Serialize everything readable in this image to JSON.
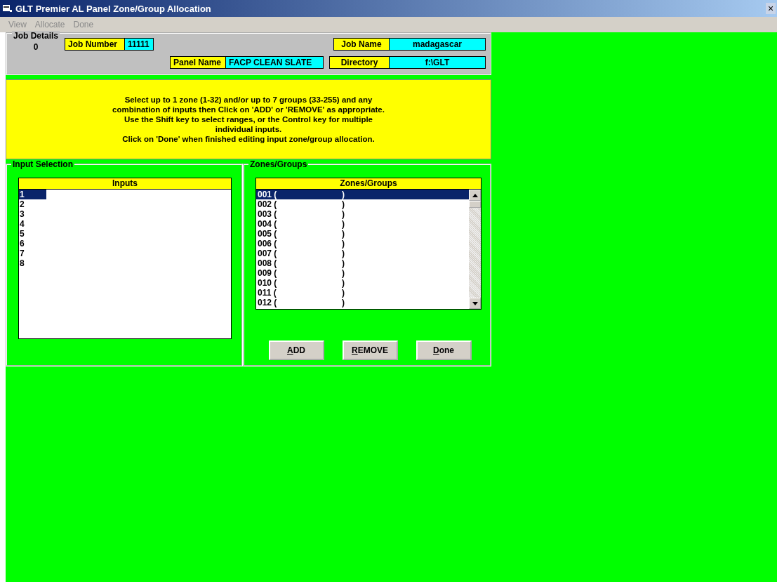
{
  "window": {
    "title": "GLT Premier AL Panel Zone/Group Allocation",
    "close": "×"
  },
  "menu": [
    {
      "label": "View",
      "disabled": true
    },
    {
      "label": "Allocate",
      "disabled": true
    },
    {
      "label": "Done",
      "disabled": true
    }
  ],
  "job_details": {
    "legend": "Job Details",
    "value": "0",
    "fields": [
      {
        "label": "Job Number",
        "value": "11111"
      },
      {
        "label": "Job Name",
        "value": "madagascar"
      },
      {
        "label": "Panel Name",
        "value": "FACP CLEAN SLATE"
      },
      {
        "label": "Directory",
        "value": "f:\\GLT"
      }
    ]
  },
  "instructions": [
    "Select up to 1 zone (1-32) and/or up to 7 groups (33-255) and any",
    "combination of inputs then Click on 'ADD' or 'REMOVE' as appropriate.",
    "Use the Shift key to select ranges, or the Control key for multiple",
    "individual inputs.",
    "Click on 'Done' when finished editing input zone/group allocation."
  ],
  "input_selection": {
    "legend": "Input Selection",
    "header": "Inputs",
    "items": [
      {
        "text": "1",
        "selected": true
      },
      {
        "text": "2",
        "selected": false
      },
      {
        "text": "3",
        "selected": false
      },
      {
        "text": "4",
        "selected": false
      },
      {
        "text": "5",
        "selected": false
      },
      {
        "text": "6",
        "selected": false
      },
      {
        "text": "7",
        "selected": false
      },
      {
        "text": "8",
        "selected": false
      }
    ]
  },
  "zones_groups": {
    "legend": "Zones/Groups",
    "header": "Zones/Groups",
    "items": [
      {
        "text": "001 (",
        "end": ")",
        "selected": true
      },
      {
        "text": "002 (",
        "end": ")",
        "selected": false
      },
      {
        "text": "003 (",
        "end": ")",
        "selected": false
      },
      {
        "text": "004 (",
        "end": ")",
        "selected": false
      },
      {
        "text": "005 (",
        "end": ")",
        "selected": false
      },
      {
        "text": "006 (",
        "end": ")",
        "selected": false
      },
      {
        "text": "007 (",
        "end": ")",
        "selected": false
      },
      {
        "text": "008 (",
        "end": ")",
        "selected": false
      },
      {
        "text": "009 (",
        "end": ")",
        "selected": false
      },
      {
        "text": "010 (",
        "end": ")",
        "selected": false
      },
      {
        "text": "011 (",
        "end": ")",
        "selected": false
      },
      {
        "text": "012 (",
        "end": ")",
        "selected": false
      }
    ]
  },
  "buttons": [
    {
      "access_key": "A",
      "label_rest": "DD"
    },
    {
      "access_key": "R",
      "label_rest": "EMOVE"
    },
    {
      "access_key": "D",
      "label_rest": "one"
    }
  ]
}
